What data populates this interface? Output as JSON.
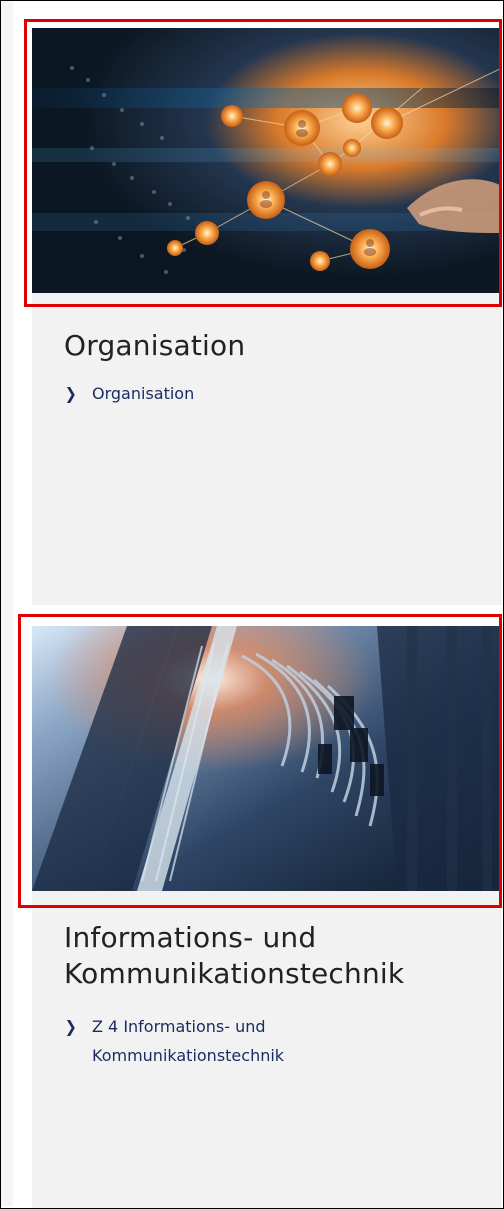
{
  "cards": [
    {
      "image_name": "people-network-image",
      "title": "Organisation",
      "link_label": "Organisation"
    },
    {
      "image_name": "server-cables-image",
      "title": "Informations- und Kommunikationstechnik",
      "link_label": "Z 4 Informations- und Kommunikationstechnik"
    }
  ],
  "icons": {
    "link_chevron": "chevron-right-icon"
  },
  "colors": {
    "highlight": "#e00000",
    "card_background": "#f2f2f2",
    "link_color": "#1a2b5f",
    "title_color": "#222222"
  }
}
